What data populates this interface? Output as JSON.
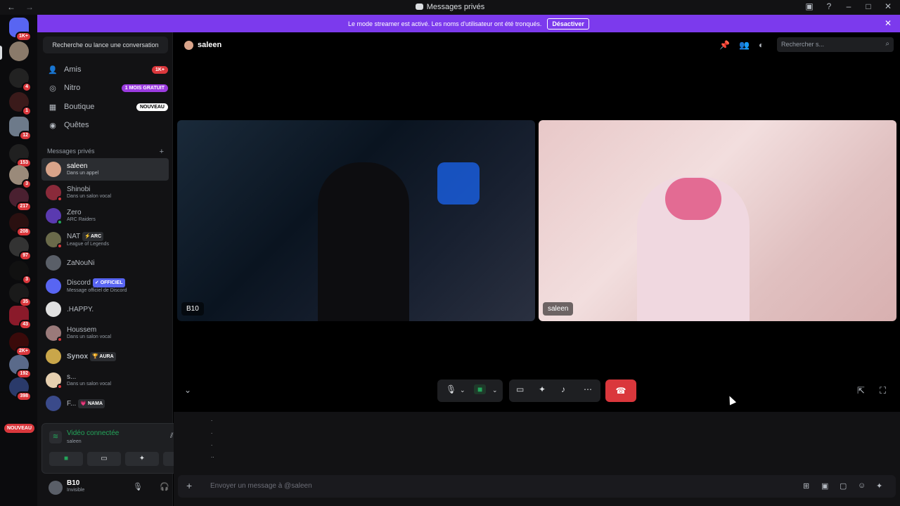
{
  "titlebar": {
    "title": "Messages privés",
    "back_icon": "←",
    "forward_icon": "→"
  },
  "banner": {
    "text": "Le mode streamer est activé. Les noms d'utilisateur ont été tronqués.",
    "button_label": "Désactiver",
    "close_glyph": "✕"
  },
  "rail": {
    "home_badge": "1K+",
    "badges": [
      "4",
      "1",
      "12",
      "153",
      "3",
      "217",
      "208",
      "97",
      "3",
      "35",
      "43",
      "2K+",
      "192",
      "398"
    ],
    "new_label": "NOUVEAU"
  },
  "sidebar": {
    "search_label": "Recherche ou lance une conversation",
    "nav": [
      {
        "label": "Amis",
        "tag": "1K+"
      },
      {
        "label": "Nitro",
        "tag": "1 MOIS GRATUIT"
      },
      {
        "label": "Boutique",
        "tag": "NOUVEAU"
      },
      {
        "label": "Quêtes",
        "tag": ""
      }
    ],
    "dm_header": "Messages privés",
    "dm_add": "+",
    "dms": [
      {
        "name": "saleen",
        "sub": "Dans un appel",
        "chip": ""
      },
      {
        "name": "Shinobi",
        "sub": "Dans un salon vocal",
        "chip": ""
      },
      {
        "name": "Zero",
        "sub": "ARC Raiders",
        "chip": ""
      },
      {
        "name": "NAT",
        "sub": "League of Legends",
        "chip": "⚡ARC"
      },
      {
        "name": "ZaNouNi",
        "sub": "",
        "chip": ""
      },
      {
        "name": "Discord",
        "sub": "Message officiel de Discord",
        "chip": "✓ OFFICIEL"
      },
      {
        "name": ".HAPPY.",
        "sub": "",
        "chip": ""
      },
      {
        "name": "Houssem",
        "sub": "Dans un salon vocal",
        "chip": ""
      },
      {
        "name": "Synox",
        "sub": "",
        "chip": "🏆 AURA"
      },
      {
        "name": "s...",
        "sub": "Dans un salon vocal",
        "chip": ""
      },
      {
        "name": "F...",
        "sub": "",
        "chip": "💗 NAMA"
      }
    ],
    "voice": {
      "title": "Vidéo connectée",
      "sub": "saleen"
    },
    "user": {
      "name": "B10",
      "status": "Invisible"
    }
  },
  "main": {
    "header": {
      "name": "saleen",
      "search_placeholder": "Rechercher s..."
    },
    "tiles": [
      {
        "label": "B10"
      },
      {
        "label": "saleen"
      }
    ],
    "chat_dots": [
      ".",
      ".",
      ".",
      ".."
    ],
    "composer_placeholder": "Envoyer un message à @saleen"
  },
  "colors": {
    "accent": "#7c3aed",
    "danger": "#da373c",
    "online": "#23a55a",
    "brand": "#5865f2"
  }
}
